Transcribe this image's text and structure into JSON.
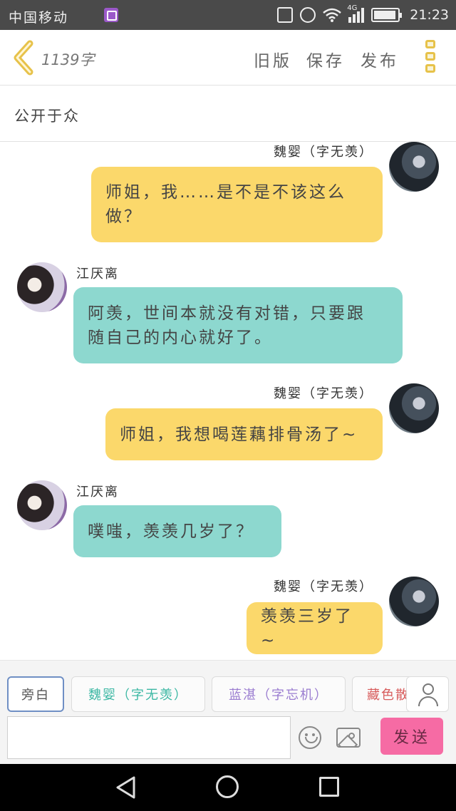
{
  "status_bar": {
    "carrier": "中国移动",
    "network": "4G",
    "time": "21:23"
  },
  "header": {
    "word_count": "1139字",
    "actions": [
      "旧版",
      "保存",
      "发布"
    ],
    "accent_color": "#e7c24a"
  },
  "visibility": "公开于众",
  "messages": [
    {
      "sender": "魏婴（字无羡）",
      "side": "right",
      "color": "#fbd86b",
      "lines": [
        "师姐，我……是不是不该这么",
        "做？"
      ]
    },
    {
      "sender": "江厌离",
      "side": "left",
      "color": "#8dd8cf",
      "lines": [
        "阿羡，世间本就没有对错，只要跟",
        "随自己的内心就好了。"
      ]
    },
    {
      "sender": "魏婴（字无羡）",
      "side": "right",
      "color": "#fbd86b",
      "lines": [
        "师姐，我想喝莲藕排骨汤了~"
      ]
    },
    {
      "sender": "江厌离",
      "side": "left",
      "color": "#8dd8cf",
      "lines": [
        "噗嗤，羡羡几岁了？"
      ]
    },
    {
      "sender": "魏婴（字无羡）",
      "side": "right",
      "color": "#fbd86b",
      "lines": [
        "羡羡三岁了~"
      ]
    }
  ],
  "characters": {
    "narration": "旁白",
    "items": [
      {
        "name": "魏婴（字无羡）",
        "color": "#3db8a4"
      },
      {
        "name": "蓝湛（字忘机）",
        "color": "#9a7cd0"
      },
      {
        "name": "藏色散",
        "color": "#d85c5c"
      }
    ]
  },
  "composer": {
    "input_value": "",
    "send_label": "发送",
    "send_color": "#f66ba4"
  }
}
